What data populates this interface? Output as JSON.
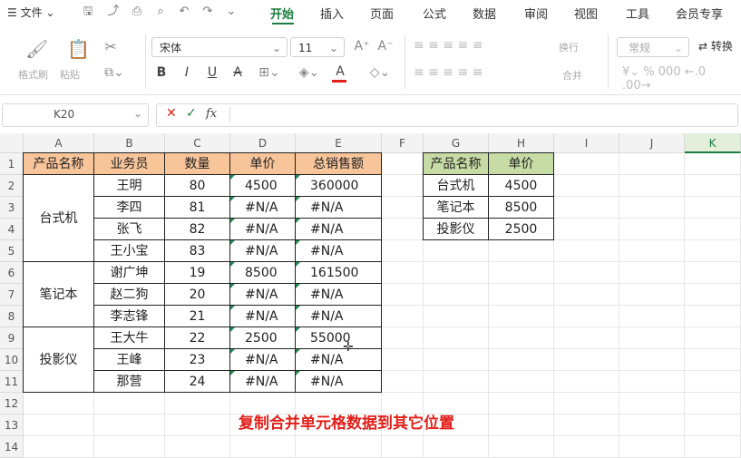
{
  "menubar": {
    "file_label": "文件",
    "tabs": [
      "开始",
      "插入",
      "页面",
      "公式",
      "数据",
      "审阅",
      "视图",
      "工具",
      "会员专享"
    ],
    "active_tab": "开始"
  },
  "ribbon": {
    "format_painter": "格式刷",
    "paste": "粘贴",
    "font_name": "宋体",
    "font_size": "11",
    "wrap": "换行",
    "merge": "合并",
    "number_format": "常规",
    "convert": "转换"
  },
  "formula_bar": {
    "name_box": "K20",
    "fx": "fx",
    "content": ""
  },
  "columns": [
    "A",
    "B",
    "C",
    "D",
    "E",
    "F",
    "G",
    "H",
    "I",
    "J",
    "K"
  ],
  "rows": [
    "1",
    "2",
    "3",
    "4",
    "5",
    "6",
    "7",
    "8",
    "9",
    "10",
    "11",
    "12",
    "13",
    "14"
  ],
  "table1": {
    "headers": [
      "产品名称",
      "业务员",
      "数量",
      "单价",
      "总销售额"
    ],
    "groups": [
      "台式机",
      "笔记本",
      "投影仪"
    ],
    "names": [
      "王明",
      "李四",
      "张飞",
      "王小宝",
      "谢广坤",
      "赵二狗",
      "李志锋",
      "王大牛",
      "王峰",
      "那营"
    ],
    "qty": [
      "80",
      "81",
      "82",
      "83",
      "19",
      "20",
      "21",
      "22",
      "23",
      "24"
    ],
    "price": [
      "4500",
      "#N/A",
      "#N/A",
      "#N/A",
      "8500",
      "#N/A",
      "#N/A",
      "2500",
      "#N/A",
      "#N/A"
    ],
    "total": [
      "360000",
      "#N/A",
      "#N/A",
      "#N/A",
      "161500",
      "#N/A",
      "#N/A",
      "55000",
      "#N/A",
      "#N/A"
    ]
  },
  "table2": {
    "headers": [
      "产品名称",
      "单价"
    ],
    "rows": [
      [
        "台式机",
        "4500"
      ],
      [
        "笔记本",
        "8500"
      ],
      [
        "投影仪",
        "2500"
      ]
    ]
  },
  "caption": "复制合并单元格数据到其它位置",
  "colors": {
    "header_orange": "#f8c49a",
    "header_green": "#c7dca4",
    "accent": "#1a7f3c",
    "caption": "#e0201a"
  }
}
